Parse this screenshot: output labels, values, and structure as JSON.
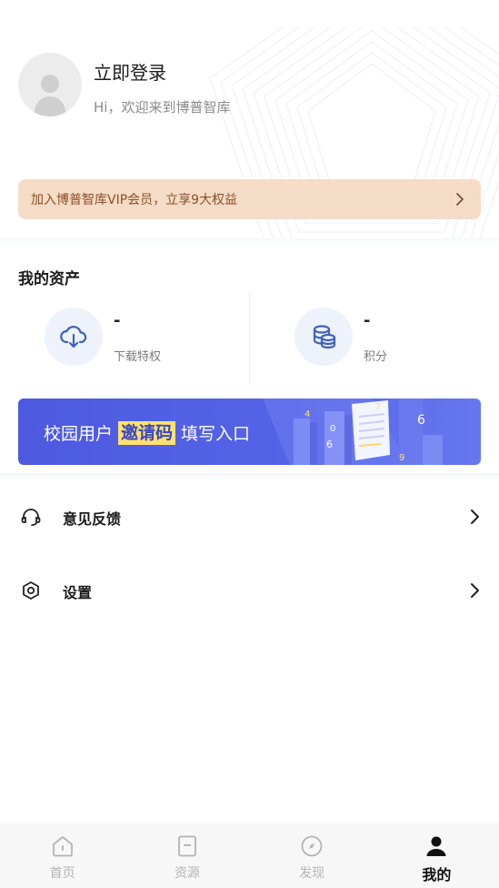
{
  "profile": {
    "login_label": "立即登录",
    "welcome_text": "Hi，欢迎来到博普智库"
  },
  "vip": {
    "text": "加入博普智库VIP会员，立享9大权益",
    "arrow_icon": "chevron-right-icon"
  },
  "assets": {
    "title": "我的资产",
    "items": [
      {
        "value": "-",
        "label": "下载特权",
        "icon": "cloud-download-icon"
      },
      {
        "value": "-",
        "label": "积分",
        "icon": "coins-icon"
      }
    ]
  },
  "campus_banner": {
    "prefix": "校园用户",
    "highlight": "邀请码",
    "suffix": "填写入口"
  },
  "menu": [
    {
      "label": "意见反馈",
      "icon": "headset-icon"
    },
    {
      "label": "设置",
      "icon": "settings-hexagon-icon"
    }
  ],
  "tabbar": {
    "active": "我的",
    "tabs": [
      {
        "label": "首页",
        "icon": "home-icon"
      },
      {
        "label": "资源",
        "icon": "document-icon"
      },
      {
        "label": "发现",
        "icon": "compass-icon"
      },
      {
        "label": "我的",
        "icon": "user-icon"
      }
    ]
  },
  "colors": {
    "vip_background": "#f5dcc7",
    "vip_text": "#8b4f26",
    "banner_blue": "#5463e6",
    "banner_highlight": "#ffe26a",
    "asset_icon": "#3e63b8"
  }
}
